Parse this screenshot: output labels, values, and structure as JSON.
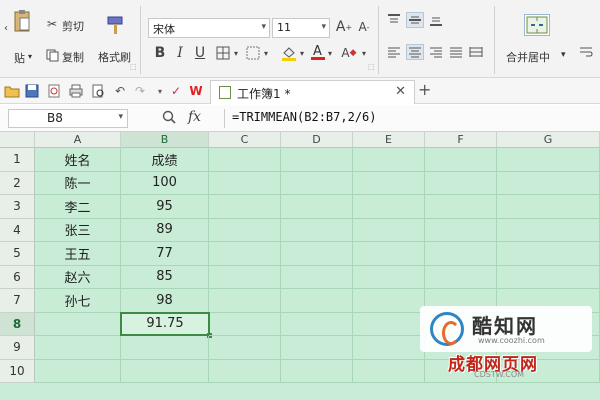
{
  "ribbon": {
    "cut_label": "剪切",
    "paste_label": "贴",
    "copy_label": "复制",
    "format_painter_label": "格式刷",
    "font_name": "宋体",
    "font_size": "11",
    "bold": "B",
    "italic": "I",
    "underline": "U",
    "merge_center_label": "合并居中"
  },
  "tabs": [
    {
      "label": "工作簿1 *"
    }
  ],
  "formula_bar": {
    "cell_ref": "B8",
    "fx_label": "fx",
    "formula": "=TRIMMEAN(B2:B7,2/6)"
  },
  "grid": {
    "columns": [
      "A",
      "B",
      "C",
      "D",
      "E",
      "F",
      "G"
    ],
    "rows": [
      "1",
      "2",
      "3",
      "4",
      "5",
      "6",
      "7",
      "8",
      "9",
      "10"
    ],
    "cells": [
      [
        "姓名",
        "成绩"
      ],
      [
        "陈一",
        "100"
      ],
      [
        "李二",
        "95"
      ],
      [
        "张三",
        "89"
      ],
      [
        "王五",
        "77"
      ],
      [
        "赵六",
        "85"
      ],
      [
        "孙七",
        "98"
      ],
      [
        "",
        "91.75"
      ],
      [
        "",
        ""
      ],
      [
        "",
        ""
      ]
    ],
    "selected_cell": "B8"
  },
  "watermarks": {
    "site1_title": "酷知网",
    "site1_url": "www.coozhi.com",
    "site2_title": "成都网页网",
    "site2_url": "CDSTW.COM"
  },
  "colors": {
    "grid_background": "#c9ecd6",
    "selection_border": "#3c8a45",
    "accent_red": "#c0261a"
  }
}
